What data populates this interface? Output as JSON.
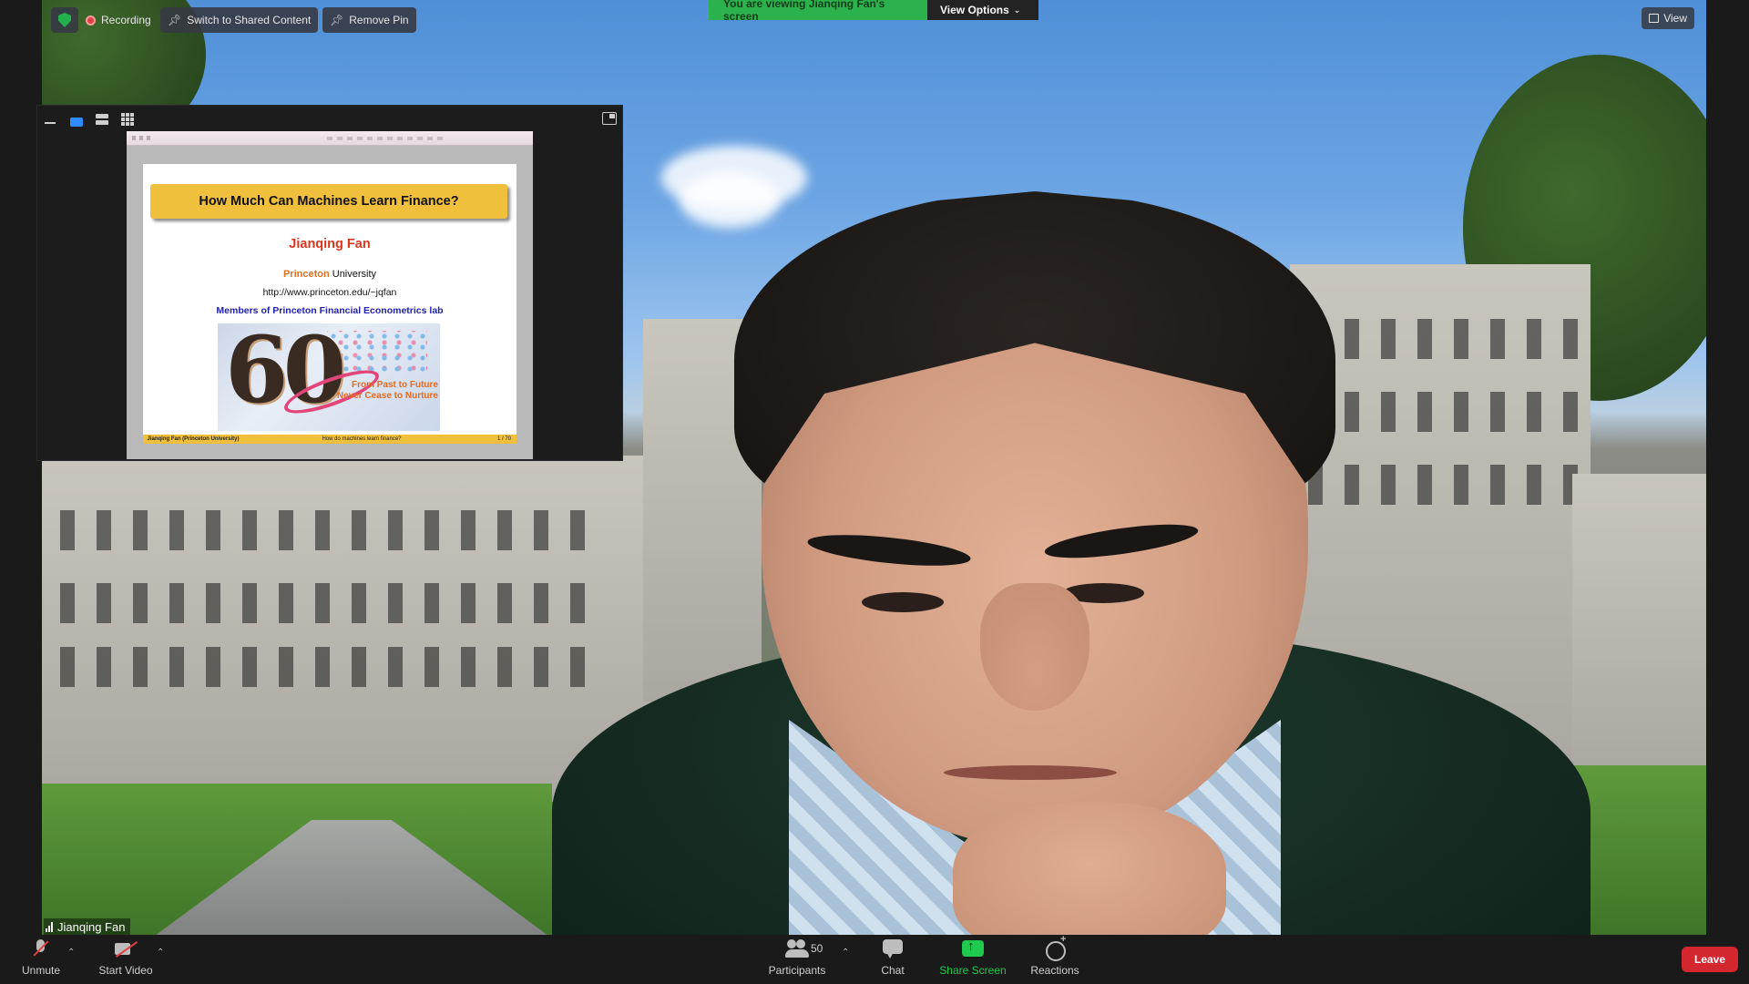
{
  "top_bar": {
    "recording_label": "Recording",
    "switch_label": "Switch to Shared Content",
    "remove_pin_label": "Remove Pin",
    "viewing_banner": "You are viewing Jianqing Fan's screen",
    "view_options_label": "View Options",
    "view_label": "View"
  },
  "slide": {
    "title": "How Much Can Machines Learn Finance?",
    "author": "Jianqing Fan",
    "org": "Princeton",
    "org_suffix": "University",
    "url": "http://www.princeton.edu/~jqfan",
    "members": "Members of Princeton Financial Econometrics lab",
    "image_big_text": "60",
    "tagline_1": "From Past to Future",
    "tagline_2": "Never Cease to Nurture",
    "footer_author": "Jianqing Fan (Princeton University)",
    "footer_title": "How do machines learn finance?",
    "footer_page": "1 / 70"
  },
  "speaker": {
    "name": "Jianqing Fan"
  },
  "toolbar": {
    "unmute_label": "Unmute",
    "start_video_label": "Start Video",
    "participants_label": "Participants",
    "participants_count": "50",
    "chat_label": "Chat",
    "share_screen_label": "Share Screen",
    "reactions_label": "Reactions",
    "leave_label": "Leave"
  },
  "colors": {
    "share_green": "#1ecb4f",
    "banner_green": "#2bb24c",
    "leave_red": "#d3262f",
    "active_blue": "#2d8cff"
  }
}
